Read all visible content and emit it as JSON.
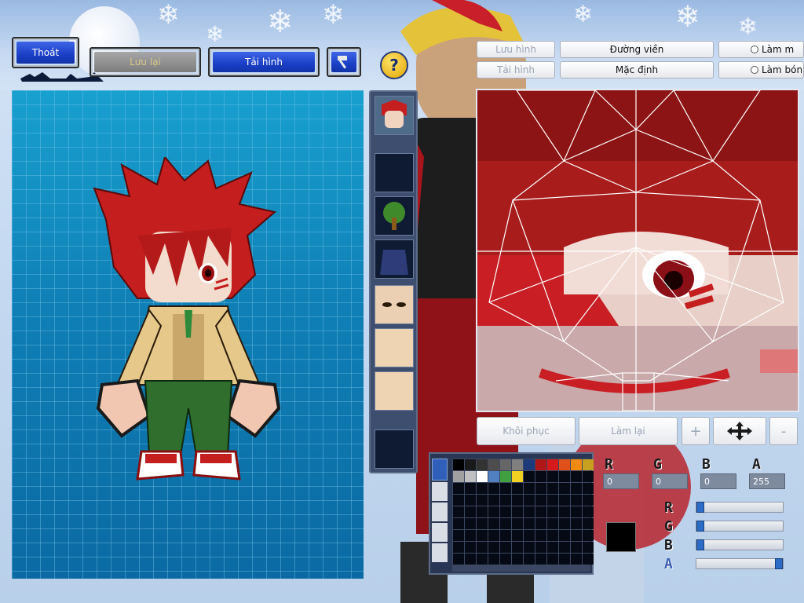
{
  "toolbar": {
    "exit_label": "Thoát",
    "save_label": "Lưu lại",
    "reload_label": "Tải hình",
    "help_icon": "question-mark-icon",
    "tool_icon": "hammer-icon"
  },
  "right_tabs": {
    "row1": [
      "Lưu hình",
      "Đường viền"
    ],
    "row2": [
      "Tải hình",
      "Mặc định"
    ],
    "radio1": "Làm m",
    "radio2": "Làm bón"
  },
  "editor_buttons": {
    "restore": "Khôi phục",
    "redo": "Làm lại",
    "plus": "+",
    "minus": "-",
    "move_icon": "move-arrows-icon"
  },
  "color": {
    "labels": [
      "R",
      "G",
      "B",
      "A"
    ],
    "values": [
      "0",
      "0",
      "0",
      "255"
    ],
    "slider_levels": [
      0,
      0,
      0,
      1.0
    ],
    "current_color": "#000000",
    "palette": [
      "#000000",
      "#1a1a1a",
      "#333333",
      "#4d4d4d",
      "#666666",
      "#808080",
      "#1f3a7a",
      "#b01818",
      "#d41a1a",
      "#e0501a",
      "#f08a10",
      "#c8a020",
      "#a0a0a0",
      "#c0c0c0",
      "#ffffff",
      "#5080c0",
      "#40a040",
      "#f0d020"
    ]
  },
  "colors": {
    "accent_blue": "#1a3fc6",
    "canvas_blue": "#1587bd",
    "hair_red": "#b62222"
  }
}
